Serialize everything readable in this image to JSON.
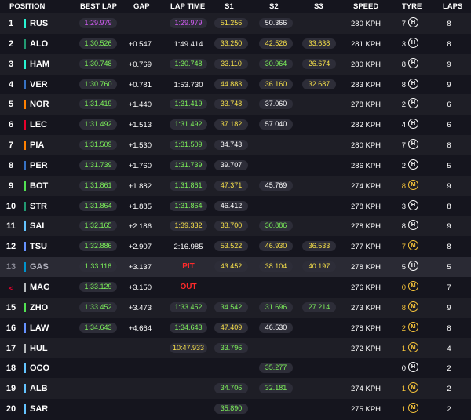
{
  "headers": {
    "position": "POSITION",
    "best_lap": "BEST LAP",
    "gap": "GAP",
    "lap_time": "LAP TIME",
    "s1": "S1",
    "s2": "S2",
    "s3": "S3",
    "speed": "SPEED",
    "tyre": "TYRE",
    "laps": "LAPS"
  },
  "tyre_letters": {
    "hard": "H",
    "medium": "M"
  },
  "colors": {
    "green": "#7df25a",
    "purple": "#d05cf2",
    "yellow": "#f7e14a",
    "status_red": "#ff2a2a",
    "tyre_hard": "#ffffff",
    "tyre_medium": "#f7c43a"
  },
  "rows": [
    {
      "pos": "1",
      "team_color": "#27f4d2",
      "code": "RUS",
      "best_lap": "1:29.979",
      "best_lap_color": "purple",
      "gap": "",
      "lap_time": "1:29.979",
      "lap_time_color": "purple",
      "lap_time_style": "pill",
      "s1": "51.256",
      "s1_color": "yellow",
      "s2": "50.366",
      "s2_color": "white",
      "s3": "",
      "s3_color": "",
      "speed": "280 KPH",
      "tyre_laps": "7",
      "tyre": "hard",
      "laps": "8"
    },
    {
      "pos": "2",
      "team_color": "#229971",
      "code": "ALO",
      "best_lap": "1:30.526",
      "best_lap_color": "green",
      "gap": "+0.547",
      "lap_time": "1:49.414",
      "lap_time_color": "white",
      "lap_time_style": "plain",
      "s1": "33.250",
      "s1_color": "yellow",
      "s2": "42.526",
      "s2_color": "yellow",
      "s3": "33.638",
      "s3_color": "yellow",
      "speed": "281 KPH",
      "tyre_laps": "3",
      "tyre": "hard",
      "laps": "8"
    },
    {
      "pos": "3",
      "team_color": "#27f4d2",
      "code": "HAM",
      "best_lap": "1:30.748",
      "best_lap_color": "green",
      "gap": "+0.769",
      "lap_time": "1:30.748",
      "lap_time_color": "green",
      "lap_time_style": "pill",
      "s1": "33.110",
      "s1_color": "yellow",
      "s2": "30.964",
      "s2_color": "green",
      "s3": "26.674",
      "s3_color": "yellow",
      "speed": "280 KPH",
      "tyre_laps": "8",
      "tyre": "hard",
      "laps": "9"
    },
    {
      "pos": "4",
      "team_color": "#3671c6",
      "code": "VER",
      "best_lap": "1:30.760",
      "best_lap_color": "green",
      "gap": "+0.781",
      "lap_time": "1:53.730",
      "lap_time_color": "white",
      "lap_time_style": "plain",
      "s1": "44.883",
      "s1_color": "yellow",
      "s2": "36.160",
      "s2_color": "yellow",
      "s3": "32.687",
      "s3_color": "yellow",
      "speed": "283 KPH",
      "tyre_laps": "8",
      "tyre": "hard",
      "laps": "9"
    },
    {
      "pos": "5",
      "team_color": "#ff8000",
      "code": "NOR",
      "best_lap": "1:31.419",
      "best_lap_color": "green",
      "gap": "+1.440",
      "lap_time": "1:31.419",
      "lap_time_color": "green",
      "lap_time_style": "pill",
      "s1": "33.748",
      "s1_color": "yellow",
      "s2": "37.060",
      "s2_color": "white",
      "s3": "",
      "s3_color": "",
      "speed": "278 KPH",
      "tyre_laps": "2",
      "tyre": "hard",
      "laps": "6"
    },
    {
      "pos": "6",
      "team_color": "#e8002d",
      "code": "LEC",
      "best_lap": "1:31.492",
      "best_lap_color": "green",
      "gap": "+1.513",
      "lap_time": "1:31.492",
      "lap_time_color": "green",
      "lap_time_style": "pill",
      "s1": "37.182",
      "s1_color": "yellow",
      "s2": "57.040",
      "s2_color": "white",
      "s3": "",
      "s3_color": "",
      "speed": "282 KPH",
      "tyre_laps": "4",
      "tyre": "hard",
      "laps": "6"
    },
    {
      "pos": "7",
      "team_color": "#ff8000",
      "code": "PIA",
      "best_lap": "1:31.509",
      "best_lap_color": "green",
      "gap": "+1.530",
      "lap_time": "1:31.509",
      "lap_time_color": "green",
      "lap_time_style": "pill",
      "s1": "34.743",
      "s1_color": "white",
      "s2": "",
      "s2_color": "",
      "s3": "",
      "s3_color": "",
      "speed": "280 KPH",
      "tyre_laps": "7",
      "tyre": "hard",
      "laps": "8"
    },
    {
      "pos": "8",
      "team_color": "#3671c6",
      "code": "PER",
      "best_lap": "1:31.739",
      "best_lap_color": "green",
      "gap": "+1.760",
      "lap_time": "1:31.739",
      "lap_time_color": "green",
      "lap_time_style": "pill",
      "s1": "39.707",
      "s1_color": "white",
      "s2": "",
      "s2_color": "",
      "s3": "",
      "s3_color": "",
      "speed": "286 KPH",
      "tyre_laps": "2",
      "tyre": "hard",
      "laps": "5"
    },
    {
      "pos": "9",
      "team_color": "#52e252",
      "code": "BOT",
      "best_lap": "1:31.861",
      "best_lap_color": "green",
      "gap": "+1.882",
      "lap_time": "1:31.861",
      "lap_time_color": "green",
      "lap_time_style": "pill",
      "s1": "47.371",
      "s1_color": "yellow",
      "s2": "45.769",
      "s2_color": "white",
      "s3": "",
      "s3_color": "",
      "speed": "274 KPH",
      "tyre_laps": "8",
      "tyre": "medium",
      "laps": "9"
    },
    {
      "pos": "10",
      "team_color": "#229971",
      "code": "STR",
      "best_lap": "1:31.864",
      "best_lap_color": "green",
      "gap": "+1.885",
      "lap_time": "1:31.864",
      "lap_time_color": "green",
      "lap_time_style": "pill",
      "s1": "46.412",
      "s1_color": "white",
      "s2": "",
      "s2_color": "",
      "s3": "",
      "s3_color": "",
      "speed": "278 KPH",
      "tyre_laps": "3",
      "tyre": "hard",
      "laps": "8"
    },
    {
      "pos": "11",
      "team_color": "#64c4ff",
      "code": "SAI",
      "best_lap": "1:32.165",
      "best_lap_color": "green",
      "gap": "+2.186",
      "lap_time": "1:39.332",
      "lap_time_color": "yellow",
      "lap_time_style": "pill",
      "s1": "33.700",
      "s1_color": "yellow",
      "s2": "30.886",
      "s2_color": "green",
      "s3": "",
      "s3_color": "",
      "speed": "278 KPH",
      "tyre_laps": "8",
      "tyre": "hard",
      "laps": "9"
    },
    {
      "pos": "12",
      "team_color": "#6692ff",
      "code": "TSU",
      "best_lap": "1:32.886",
      "best_lap_color": "green",
      "gap": "+2.907",
      "lap_time": "2:16.985",
      "lap_time_color": "white",
      "lap_time_style": "plain",
      "s1": "53.522",
      "s1_color": "yellow",
      "s2": "46.930",
      "s2_color": "yellow",
      "s3": "36.533",
      "s3_color": "yellow",
      "speed": "277 KPH",
      "tyre_laps": "7",
      "tyre": "medium",
      "laps": "8"
    },
    {
      "pos": "13",
      "team_color": "#0093cc",
      "code": "GAS",
      "best_lap": "1:33.116",
      "best_lap_color": "green",
      "gap": "+3.137",
      "lap_time": "PIT",
      "lap_time_color": "red",
      "lap_time_style": "status",
      "s1": "43.452",
      "s1_color": "yellow",
      "s2": "38.104",
      "s2_color": "yellow",
      "s3": "40.197",
      "s3_color": "yellow",
      "speed": "278 KPH",
      "tyre_laps": "5",
      "tyre": "hard",
      "laps": "5",
      "dim": true
    },
    {
      "pos": "◃",
      "team_color": "#b6babd",
      "code": "MAG",
      "best_lap": "1:33.129",
      "best_lap_color": "green",
      "gap": "+3.150",
      "lap_time": "OUT",
      "lap_time_color": "red",
      "lap_time_style": "status",
      "s1": "",
      "s1_color": "",
      "s2": "",
      "s2_color": "",
      "s3": "",
      "s3_color": "",
      "speed": "276 KPH",
      "tyre_laps": "0",
      "tyre": "medium",
      "laps": "7",
      "retired": true
    },
    {
      "pos": "15",
      "team_color": "#52e252",
      "code": "ZHO",
      "best_lap": "1:33.452",
      "best_lap_color": "green",
      "gap": "+3.473",
      "lap_time": "1:33.452",
      "lap_time_color": "green",
      "lap_time_style": "pill",
      "s1": "34.542",
      "s1_color": "green",
      "s2": "31.696",
      "s2_color": "green",
      "s3": "27.214",
      "s3_color": "green",
      "speed": "273 KPH",
      "tyre_laps": "8",
      "tyre": "medium",
      "laps": "9"
    },
    {
      "pos": "16",
      "team_color": "#6692ff",
      "code": "LAW",
      "best_lap": "1:34.643",
      "best_lap_color": "green",
      "gap": "+4.664",
      "lap_time": "1:34.643",
      "lap_time_color": "green",
      "lap_time_style": "pill",
      "s1": "47.409",
      "s1_color": "yellow",
      "s2": "46.530",
      "s2_color": "white",
      "s3": "",
      "s3_color": "",
      "speed": "278 KPH",
      "tyre_laps": "2",
      "tyre": "medium",
      "laps": "8"
    },
    {
      "pos": "17",
      "team_color": "#b6babd",
      "code": "HUL",
      "best_lap": "",
      "best_lap_color": "",
      "gap": "",
      "lap_time": "10:47.933",
      "lap_time_color": "yellow",
      "lap_time_style": "pill",
      "s1": "33.796",
      "s1_color": "green",
      "s2": "",
      "s2_color": "",
      "s3": "",
      "s3_color": "",
      "speed": "272 KPH",
      "tyre_laps": "1",
      "tyre": "medium",
      "laps": "4"
    },
    {
      "pos": "18",
      "team_color": "#64c4ff",
      "code": "OCO",
      "best_lap": "",
      "best_lap_color": "",
      "gap": "",
      "lap_time": "",
      "lap_time_color": "",
      "lap_time_style": "none",
      "s1": "",
      "s1_color": "",
      "s2": "35.277",
      "s2_color": "green",
      "s3": "",
      "s3_color": "",
      "speed": "",
      "tyre_laps": "0",
      "tyre": "hard",
      "laps": "2"
    },
    {
      "pos": "19",
      "team_color": "#64c4ff",
      "code": "ALB",
      "best_lap": "",
      "best_lap_color": "",
      "gap": "",
      "lap_time": "",
      "lap_time_color": "",
      "lap_time_style": "none",
      "s1": "34.706",
      "s1_color": "green",
      "s2": "32.181",
      "s2_color": "green",
      "s3": "",
      "s3_color": "",
      "speed": "274 KPH",
      "tyre_laps": "1",
      "tyre": "medium",
      "laps": "2"
    },
    {
      "pos": "20",
      "team_color": "#64c4ff",
      "code": "SAR",
      "best_lap": "",
      "best_lap_color": "",
      "gap": "",
      "lap_time": "",
      "lap_time_color": "",
      "lap_time_style": "none",
      "s1": "35.890",
      "s1_color": "green",
      "s2": "",
      "s2_color": "",
      "s3": "",
      "s3_color": "",
      "speed": "275 KPH",
      "tyre_laps": "1",
      "tyre": "medium",
      "laps": "2"
    }
  ]
}
